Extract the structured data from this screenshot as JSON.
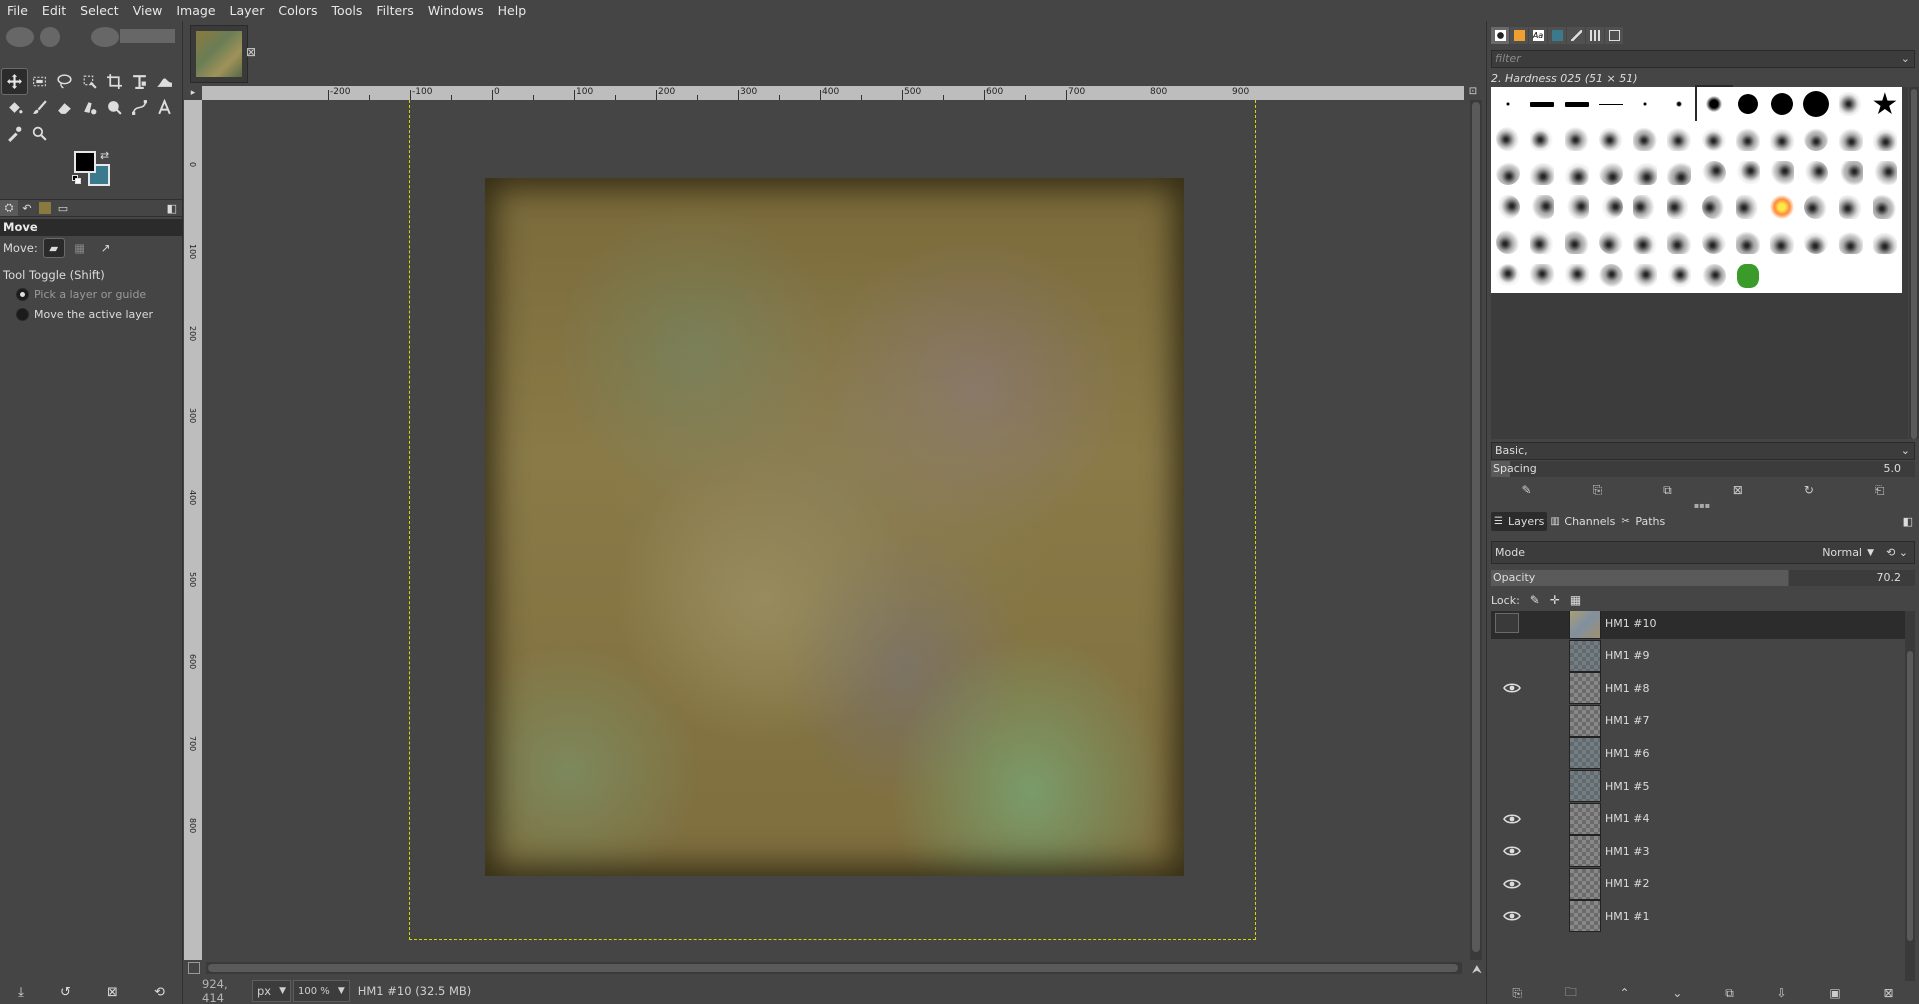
{
  "menubar": [
    "File",
    "Edit",
    "Select",
    "View",
    "Image",
    "Layer",
    "Colors",
    "Tools",
    "Filters",
    "Windows",
    "Help"
  ],
  "toolbox": {
    "tool_options_title": "Move",
    "move_label": "Move:",
    "toggle_label": "Tool Toggle  (Shift)",
    "radio1": "Pick a layer or guide",
    "radio2": "Move the active layer",
    "fg_color": "#000000",
    "bg_color": "#3b7a8c"
  },
  "canvas": {
    "hruler_labels": [
      "-200",
      "-100",
      "0",
      "100",
      "200",
      "300",
      "400",
      "500",
      "600",
      "700",
      "800",
      "900"
    ],
    "vruler_labels": [
      "0",
      "100",
      "200",
      "300",
      "400",
      "500",
      "600",
      "700",
      "800"
    ]
  },
  "status": {
    "coords": "924, 414",
    "unit": "px",
    "zoom": "100 %",
    "info": "HM1 #10 (32.5 MB)"
  },
  "brushes": {
    "filter_placeholder": "filter",
    "current": "2. Hardness 025 (51 × 51)",
    "tag": "Basic,",
    "spacing_label": "Spacing",
    "spacing_value": "5.0"
  },
  "layers_panel": {
    "tabs": [
      "Layers",
      "Channels",
      "Paths"
    ],
    "mode_label": "Mode",
    "mode_value": "Normal",
    "opacity_label": "Opacity",
    "opacity_value": "70.2",
    "lock_label": "Lock:",
    "layers": [
      {
        "name": "HM1 #10",
        "visible": false,
        "selected": true
      },
      {
        "name": "HM1 #9",
        "visible": false,
        "selected": false
      },
      {
        "name": "HM1 #8",
        "visible": true,
        "selected": false
      },
      {
        "name": "HM1 #7",
        "visible": false,
        "selected": false
      },
      {
        "name": "HM1 #6",
        "visible": false,
        "selected": false
      },
      {
        "name": "HM1 #5",
        "visible": false,
        "selected": false
      },
      {
        "name": "HM1 #4",
        "visible": true,
        "selected": false
      },
      {
        "name": "HM1 #3",
        "visible": true,
        "selected": false
      },
      {
        "name": "HM1 #2",
        "visible": true,
        "selected": false
      },
      {
        "name": "HM1 #1",
        "visible": true,
        "selected": false
      }
    ]
  }
}
